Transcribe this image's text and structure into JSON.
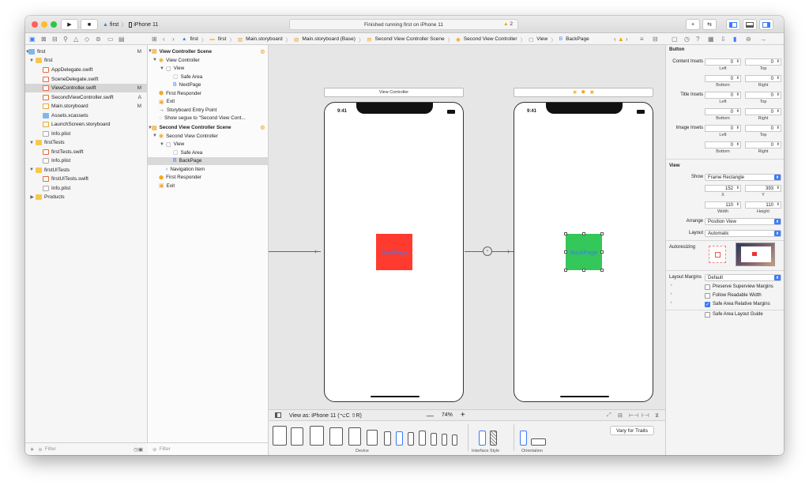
{
  "titlebar": {
    "scheme_target": "first",
    "scheme_device": "iPhone 11",
    "status": "Finished running first on iPhone 11",
    "warnings": "2"
  },
  "jumpbar": [
    "first",
    "first",
    "Main.storyboard",
    "Main.storyboard (Base)",
    "Second View Controller Scene",
    "Second View Controller",
    "View",
    "BackPage"
  ],
  "navigator": {
    "items": [
      {
        "label": "first",
        "level": 0,
        "icon": "project",
        "badge": "M"
      },
      {
        "label": "first",
        "level": 1,
        "icon": "folder",
        "badge": ""
      },
      {
        "label": "AppDelegate.swift",
        "level": 2,
        "icon": "swift",
        "badge": ""
      },
      {
        "label": "SceneDelegate.swift",
        "level": 2,
        "icon": "swift",
        "badge": ""
      },
      {
        "label": "ViewController.swift",
        "level": 2,
        "icon": "swift",
        "badge": "M"
      },
      {
        "label": "SecondViewController.swift",
        "level": 2,
        "icon": "swift",
        "badge": "A"
      },
      {
        "label": "Main.storyboard",
        "level": 2,
        "icon": "storyboard",
        "badge": "M"
      },
      {
        "label": "Assets.xcassets",
        "level": 2,
        "icon": "assets",
        "badge": ""
      },
      {
        "label": "LaunchScreen.storyboard",
        "level": 2,
        "icon": "storyboard",
        "badge": ""
      },
      {
        "label": "Info.plist",
        "level": 2,
        "icon": "plist",
        "badge": ""
      },
      {
        "label": "firstTests",
        "level": 1,
        "icon": "folder",
        "badge": ""
      },
      {
        "label": "firstTests.swift",
        "level": 2,
        "icon": "swift",
        "badge": ""
      },
      {
        "label": "Info.plist",
        "level": 2,
        "icon": "plist",
        "badge": ""
      },
      {
        "label": "firstUITests",
        "level": 1,
        "icon": "folder",
        "badge": ""
      },
      {
        "label": "firstUITests.swift",
        "level": 2,
        "icon": "swift",
        "badge": ""
      },
      {
        "label": "Info.plist",
        "level": 2,
        "icon": "plist",
        "badge": ""
      },
      {
        "label": "Products",
        "level": 1,
        "icon": "folder",
        "badge": ""
      }
    ],
    "filter_placeholder": "Filter"
  },
  "outline": {
    "items": [
      {
        "label": "View Controller Scene",
        "level": 0,
        "bold": true
      },
      {
        "label": "View Controller",
        "level": 1,
        "bold": false
      },
      {
        "label": "View",
        "level": 2,
        "bold": false
      },
      {
        "label": "Safe Area",
        "level": 3,
        "bold": false
      },
      {
        "label": "NextPage",
        "level": 3,
        "bold": false
      },
      {
        "label": "First Responder",
        "level": 1,
        "bold": false
      },
      {
        "label": "Exit",
        "level": 1,
        "bold": false
      },
      {
        "label": "Storyboard Entry Point",
        "level": 1,
        "bold": false
      },
      {
        "label": "Show segue to \"Second View Cont...",
        "level": 1,
        "bold": false
      },
      {
        "label": "Second View Controller Scene",
        "level": 0,
        "bold": true
      },
      {
        "label": "Second View Controller",
        "level": 1,
        "bold": false
      },
      {
        "label": "View",
        "level": 2,
        "bold": false
      },
      {
        "label": "Safe Area",
        "level": 3,
        "bold": false
      },
      {
        "label": "BackPage",
        "level": 3,
        "bold": false
      },
      {
        "label": "Navigation Item",
        "level": 2,
        "bold": false
      },
      {
        "label": "First Responder",
        "level": 1,
        "bold": false
      },
      {
        "label": "Exit",
        "level": 1,
        "bold": false
      }
    ],
    "filter_placeholder": "Filter"
  },
  "canvas": {
    "vc1_title": "View Controller",
    "time1": "9:41",
    "time2": "9:41",
    "button1": "NextPage",
    "button2": "BackPage",
    "view_as": "View as: iPhone 11 (⌥C ⇧R)",
    "zoom": "74%",
    "device_label": "Device",
    "interface_label": "Interface Style",
    "orientation_label": "Orientation",
    "vary_button": "Vary for Traits"
  },
  "inspector": {
    "section_button": "Button",
    "content_insets": "Content Insets",
    "title_insets": "Title Insets",
    "image_insets": "Image Insets",
    "zero": "0",
    "left": "Left",
    "top": "Top",
    "bottom": "Bottom",
    "right": "Right",
    "section_view": "View",
    "show_label": "Show",
    "show_value": "Frame Rectangle",
    "x_val": "152",
    "y_val": "393",
    "x_lbl": "X",
    "y_lbl": "Y",
    "w_val": "110",
    "h_val": "110",
    "w_lbl": "Width",
    "h_lbl": "Height",
    "arrange_label": "Arrange",
    "arrange_value": "Position View",
    "layout_label": "Layout",
    "layout_value": "Automatic",
    "autoresizing_label": "Autoresizing",
    "margins_label": "Layout Margins",
    "margins_value": "Default",
    "cb1": "Preserve Superview Margins",
    "cb2": "Follow Readable Width",
    "cb3": "Safe Area Relative Margins",
    "cb4": "Safe Area Layout Guide"
  },
  "colors": {
    "red": "#ff3b30",
    "green": "#34c759",
    "accent": "#3a7bfd"
  }
}
